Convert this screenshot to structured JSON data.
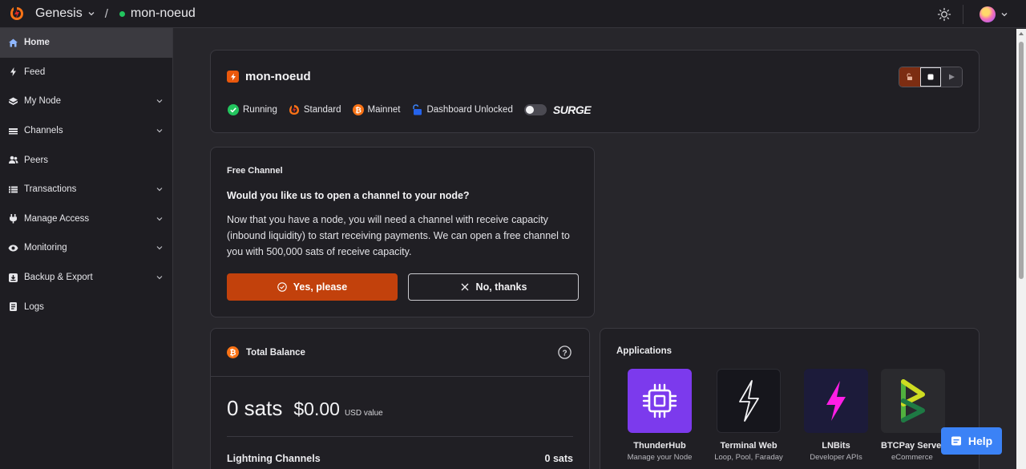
{
  "topbar": {
    "workspace": "Genesis",
    "separator": "/",
    "node_name": "mon-noeud"
  },
  "sidebar": {
    "items": [
      {
        "label": "Home",
        "icon": "home-icon",
        "active": true,
        "expandable": false
      },
      {
        "label": "Feed",
        "icon": "bolt-icon",
        "active": false,
        "expandable": false
      },
      {
        "label": "My Node",
        "icon": "cube-icon",
        "active": false,
        "expandable": true
      },
      {
        "label": "Channels",
        "icon": "channels-icon",
        "active": false,
        "expandable": true
      },
      {
        "label": "Peers",
        "icon": "users-icon",
        "active": false,
        "expandable": false
      },
      {
        "label": "Transactions",
        "icon": "list-icon",
        "active": false,
        "expandable": true
      },
      {
        "label": "Manage Access",
        "icon": "plug-icon",
        "active": false,
        "expandable": true
      },
      {
        "label": "Monitoring",
        "icon": "eye-icon",
        "active": false,
        "expandable": true
      },
      {
        "label": "Backup & Export",
        "icon": "download-icon",
        "active": false,
        "expandable": true
      },
      {
        "label": "Logs",
        "icon": "document-icon",
        "active": false,
        "expandable": false
      }
    ]
  },
  "node_card": {
    "title": "mon-noeud",
    "statuses": {
      "running": "Running",
      "standard": "Standard",
      "mainnet": "Mainnet",
      "dashboard": "Dashboard Unlocked"
    },
    "surge_label": "SURGE"
  },
  "free_channel": {
    "label": "Free Channel",
    "question": "Would you like us to open a channel to your node?",
    "body": "Now that you have a node, you will need a channel with receive capacity (inbound liquidity) to start receiving payments. We can open a free channel to you with 500,000 sats of receive capacity.",
    "yes_label": "Yes, please",
    "no_label": "No, thanks"
  },
  "balance": {
    "title": "Total Balance",
    "sats": "0 sats",
    "usd": "$0.00",
    "usd_label": "USD value",
    "lightning_label": "Lightning Channels",
    "lightning_value": "0 sats"
  },
  "applications": {
    "title": "Applications",
    "apps": [
      {
        "name": "ThunderHub",
        "sub": "Manage your Node",
        "color": "#7c3aed"
      },
      {
        "name": "Terminal Web",
        "sub": "Loop, Pool, Faraday",
        "color": "#16161c"
      },
      {
        "name": "LNBits",
        "sub": "Developer APIs",
        "color": "#1c1b3a"
      },
      {
        "name": "BTCPay Server",
        "sub": "eCommerce",
        "color": "#2a2a2e"
      }
    ]
  },
  "help_button": "Help",
  "colors": {
    "accent": "#c2410c",
    "running": "#22c55e",
    "bitcoin": "#f97316",
    "help": "#3b82f6"
  }
}
